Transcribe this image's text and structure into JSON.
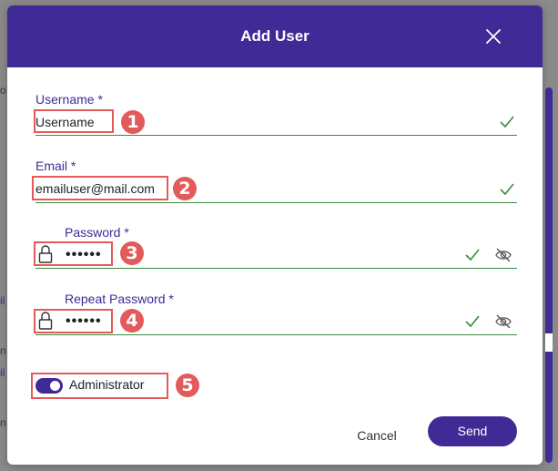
{
  "dialog": {
    "title": "Add User",
    "close_label": "close"
  },
  "fields": {
    "username": {
      "label": "Username *",
      "value": "Username"
    },
    "email": {
      "label": "Email *",
      "value": "emailuser@mail.com"
    },
    "password": {
      "label": "Password *",
      "value": "••••••"
    },
    "repeat_password": {
      "label": "Repeat Password *",
      "value": "••••••"
    }
  },
  "toggle": {
    "label": "Administrator",
    "checked": true
  },
  "actions": {
    "cancel_label": "Cancel",
    "send_label": "Send"
  },
  "steps": [
    "1",
    "2",
    "3",
    "4",
    "5"
  ],
  "colors": {
    "primary": "#3f2a96",
    "valid": "#3f8a3f",
    "highlight": "#e35a5a"
  },
  "icons": [
    "close-icon",
    "check-icon",
    "lock-icon",
    "eye-slash-icon"
  ]
}
